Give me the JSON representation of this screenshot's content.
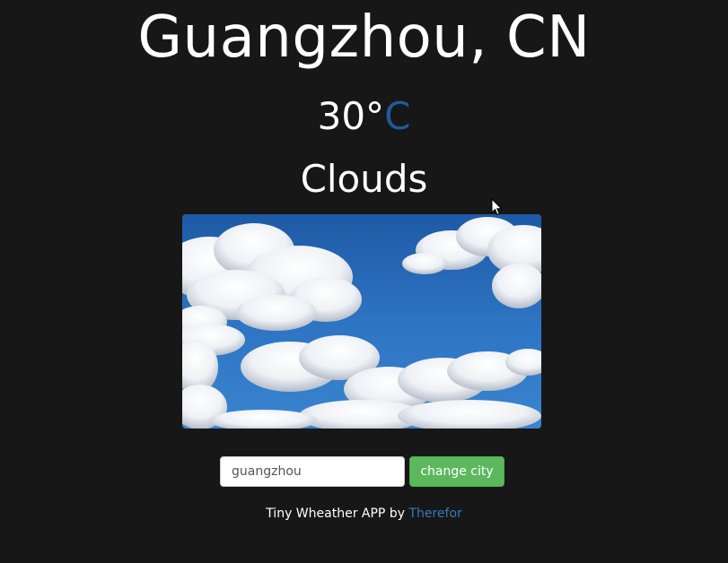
{
  "location": {
    "city": "Guangzhou, CN"
  },
  "weather": {
    "temperature": "30°",
    "unit": "C",
    "condition": "Clouds",
    "image_icon": "clouds-sky-photo"
  },
  "form": {
    "input_value": "guangzhou",
    "button_label": "change city"
  },
  "footer": {
    "text": "Tiny Wheather APP by",
    "link_text": "Therefor"
  },
  "colors": {
    "background": "#171717",
    "unit_accent": "#1f5b97",
    "button_green": "#5cb85c",
    "link_blue": "#337ab7"
  }
}
